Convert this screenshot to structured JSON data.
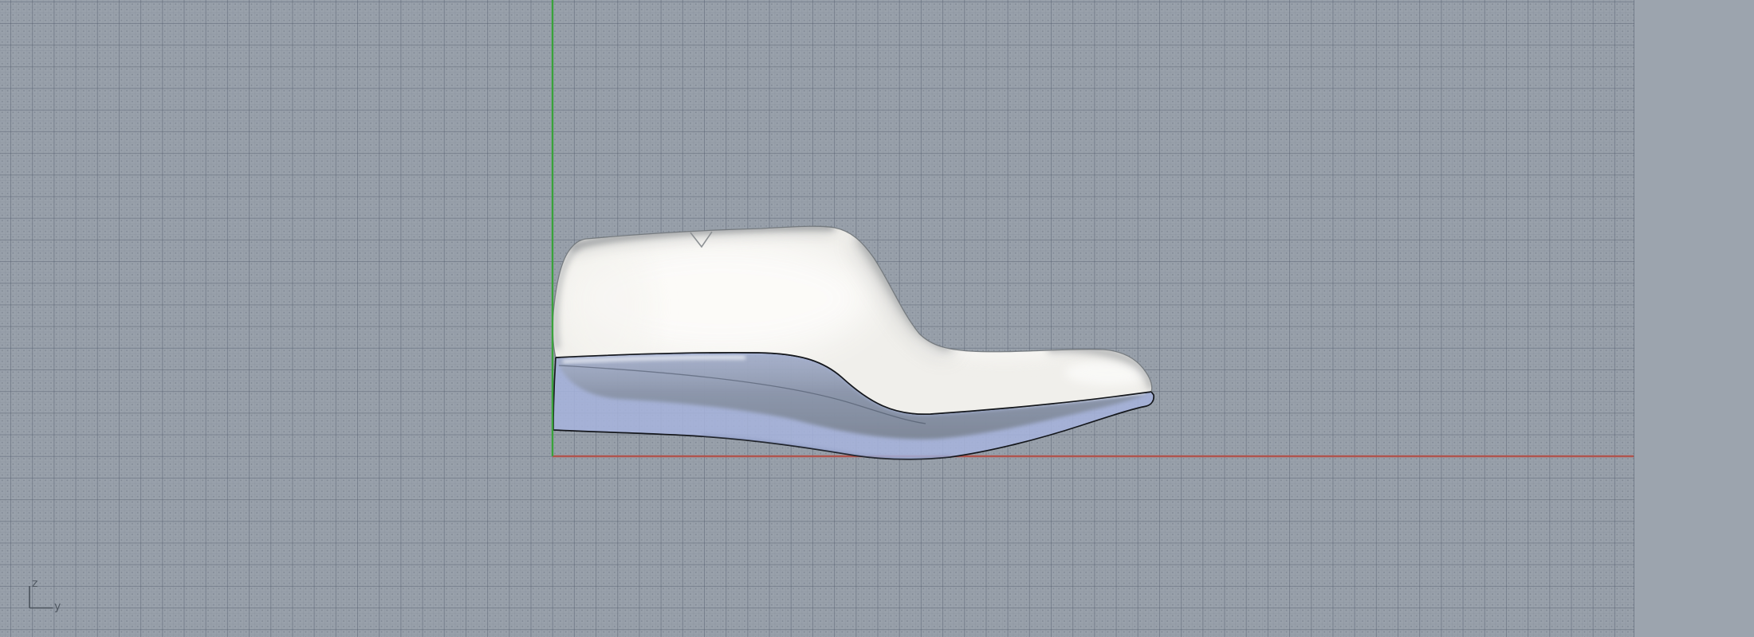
{
  "viewport": {
    "background_color": "#99a1ab",
    "offgrid_color": "#9ca4ae",
    "axes": {
      "vertical_color": "#3aa23c",
      "horizontal_color": "#b0544e"
    },
    "axis_gizmo": {
      "z_label": "z",
      "y_label": "y"
    }
  },
  "model": {
    "last_color": "#f0efeb",
    "sole_color": "#a7b4dd",
    "outline_color": "#14171c"
  }
}
